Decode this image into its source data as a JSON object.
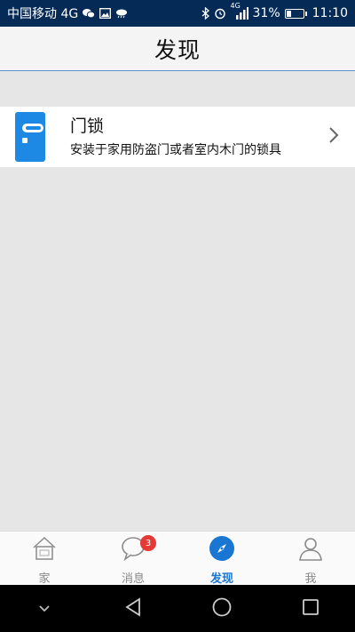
{
  "status_bar": {
    "carrier": "中国移动 4G",
    "small_4g": "4G",
    "battery_percent": "31%",
    "battery_level": 0.31,
    "time": "11:10"
  },
  "header": {
    "title": "发现"
  },
  "feature_item": {
    "title": "门锁",
    "description": "安装于家用防盗门或者室内木门的锁具",
    "icon": "door-lock-icon",
    "icon_color": "#1e88e5"
  },
  "bottom_nav": {
    "items": [
      {
        "label": "家",
        "icon": "home-icon",
        "active": false
      },
      {
        "label": "消息",
        "icon": "chat-icon",
        "active": false,
        "badge": "3"
      },
      {
        "label": "发现",
        "icon": "compass-icon",
        "active": true
      },
      {
        "label": "我",
        "icon": "person-icon",
        "active": false
      }
    ],
    "active_color": "#1976d2",
    "badge_color": "#e53935"
  },
  "android_nav": {
    "buttons": [
      "chevron-down-icon",
      "back-icon",
      "home-circle-icon",
      "recents-icon"
    ]
  }
}
